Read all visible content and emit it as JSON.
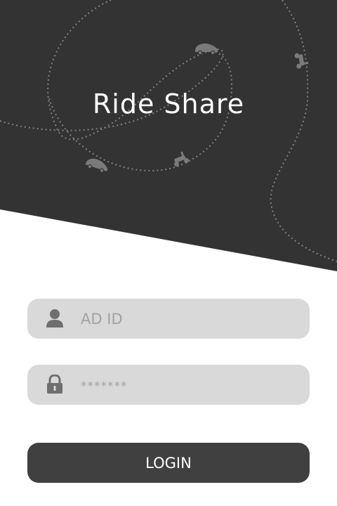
{
  "app": {
    "title": "Ride Share"
  },
  "login_form": {
    "username_placeholder": "AD ID",
    "password_placeholder": "*******",
    "login_label": "LOGIN"
  },
  "icons": {
    "user": "user-icon",
    "lock": "lock-icon",
    "car": "car-icon",
    "scooter": "scooter-icon"
  },
  "colors": {
    "header_background": "#333333",
    "field_background": "#d9d9d9",
    "button_background": "#404040",
    "decoration_line": "#888888"
  }
}
